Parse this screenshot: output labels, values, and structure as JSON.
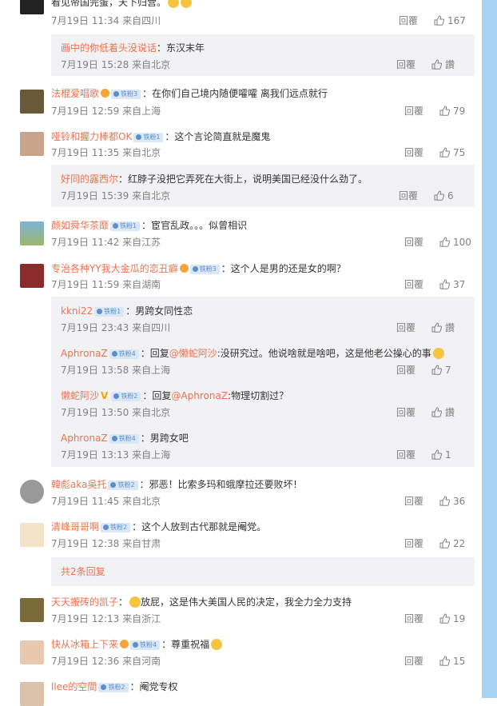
{
  "top": {
    "text": "看见帝国完蛋，天下归营。",
    "time": "7月19日 11:34 来自四川",
    "reply": "回覆",
    "likes": "167"
  },
  "sub0": {
    "user": "画中的你低着头没说话",
    "text": "：东汉末年",
    "time": "7月19日 15:28 来自北京",
    "reply": "回覆",
    "likes": "讚"
  },
  "c1": {
    "user": "法棍爱唱歌",
    "badge": "铁粉3",
    "text": "：在你们自己境内随便嚯嚯 离我们远点就行",
    "time": "7月19日 12:59 来自上海",
    "reply": "回覆",
    "likes": "79"
  },
  "c2": {
    "user": "哑铃和握力棒都OK",
    "badge": "铁粉1",
    "text": "：这个言论简直就是魔鬼",
    "time": "7月19日 11:35 来自北京",
    "reply": "回覆",
    "likes": "75"
  },
  "sub2": {
    "user": "好同的露西尔",
    "text": "：红脖子没把它弄死在大街上，说明美国已经没什么劲了。",
    "time": "7月19日 15:39 来自北京",
    "reply": "回覆",
    "likes": "6"
  },
  "c3": {
    "user": "颜如舜华茶靡",
    "badge": "铁粉1",
    "text": "：宦官乱政。。。似曾相识",
    "time": "7月19日 11:42 来自江苏",
    "reply": "回覆",
    "likes": "100"
  },
  "c4": {
    "user": "专治各种YY我大金瓜的恋丑癖",
    "badge": "铁粉3",
    "text": "：这个人是男的还是女的啊？",
    "time": "7月19日 11:59 来自湖南",
    "reply": "回覆",
    "likes": "37"
  },
  "sub4a": {
    "user": "kkni22",
    "badge": "铁粉1",
    "text": "：男跨女同性恋",
    "time": "7月19日 23:43 来自四川",
    "reply": "回覆",
    "likes": "讚"
  },
  "sub4b": {
    "user": "AphronaZ",
    "badge": "铁粉4",
    "pre": "：回复",
    "mention": "@懒蛇阿沙",
    "text": ":没研究过。他说啥就是啥吧，这是他老公操心的事",
    "time": "7月19日 13:58 来自上海",
    "reply": "回覆",
    "likes": "7"
  },
  "sub4c": {
    "user": "懒蛇阿沙",
    "v": "V",
    "badge": "铁粉2",
    "pre": "：回复",
    "mention": "@AphronaZ",
    "text": ":物理切割过？",
    "time": "7月19日 13:50 来自北京",
    "reply": "回覆",
    "likes": "讚"
  },
  "sub4d": {
    "user": "AphronaZ",
    "badge": "铁粉4",
    "text": "：男跨女吧",
    "time": "7月19日 13:13 来自上海",
    "reply": "回覆",
    "likes": "1"
  },
  "c5": {
    "user": "韓彪aka吳托",
    "badge": "铁粉2",
    "text": "：邪恶！比索多玛和蛾摩拉还要败坏！",
    "time": "7月19日 11:45 来自北京",
    "reply": "回覆",
    "likes": "36"
  },
  "c6": {
    "user": "清峰哥哥啊",
    "badge": "铁粉2",
    "text": "：这个人放到古代那就是阉党。",
    "time": "7月19日 12:38 来自甘肃",
    "reply": "回覆",
    "likes": "22"
  },
  "more6": "共2条回复",
  "c7": {
    "user": "天天搬砖的凯子",
    "text": "放屁，这是伟大美国人民的决定，我全力全力支持",
    "time": "7月19日 12:13 来自浙江",
    "reply": "回覆",
    "likes": "19"
  },
  "c8": {
    "user": "快从冰箱上下来",
    "badge": "铁粉4",
    "text": "：尊重祝福",
    "time": "7月19日 12:36 来自河南",
    "reply": "回覆",
    "likes": "15"
  },
  "c9": {
    "user": "llee的空間",
    "badge": "铁粉2",
    "text": "：阉党专权"
  },
  "colors": {
    "nick": "#eb7350",
    "meta": "#808080",
    "sub_bg": "#f2f2f5",
    "side": "#a8d3f0",
    "badge_bg": "#d9e7f7"
  }
}
